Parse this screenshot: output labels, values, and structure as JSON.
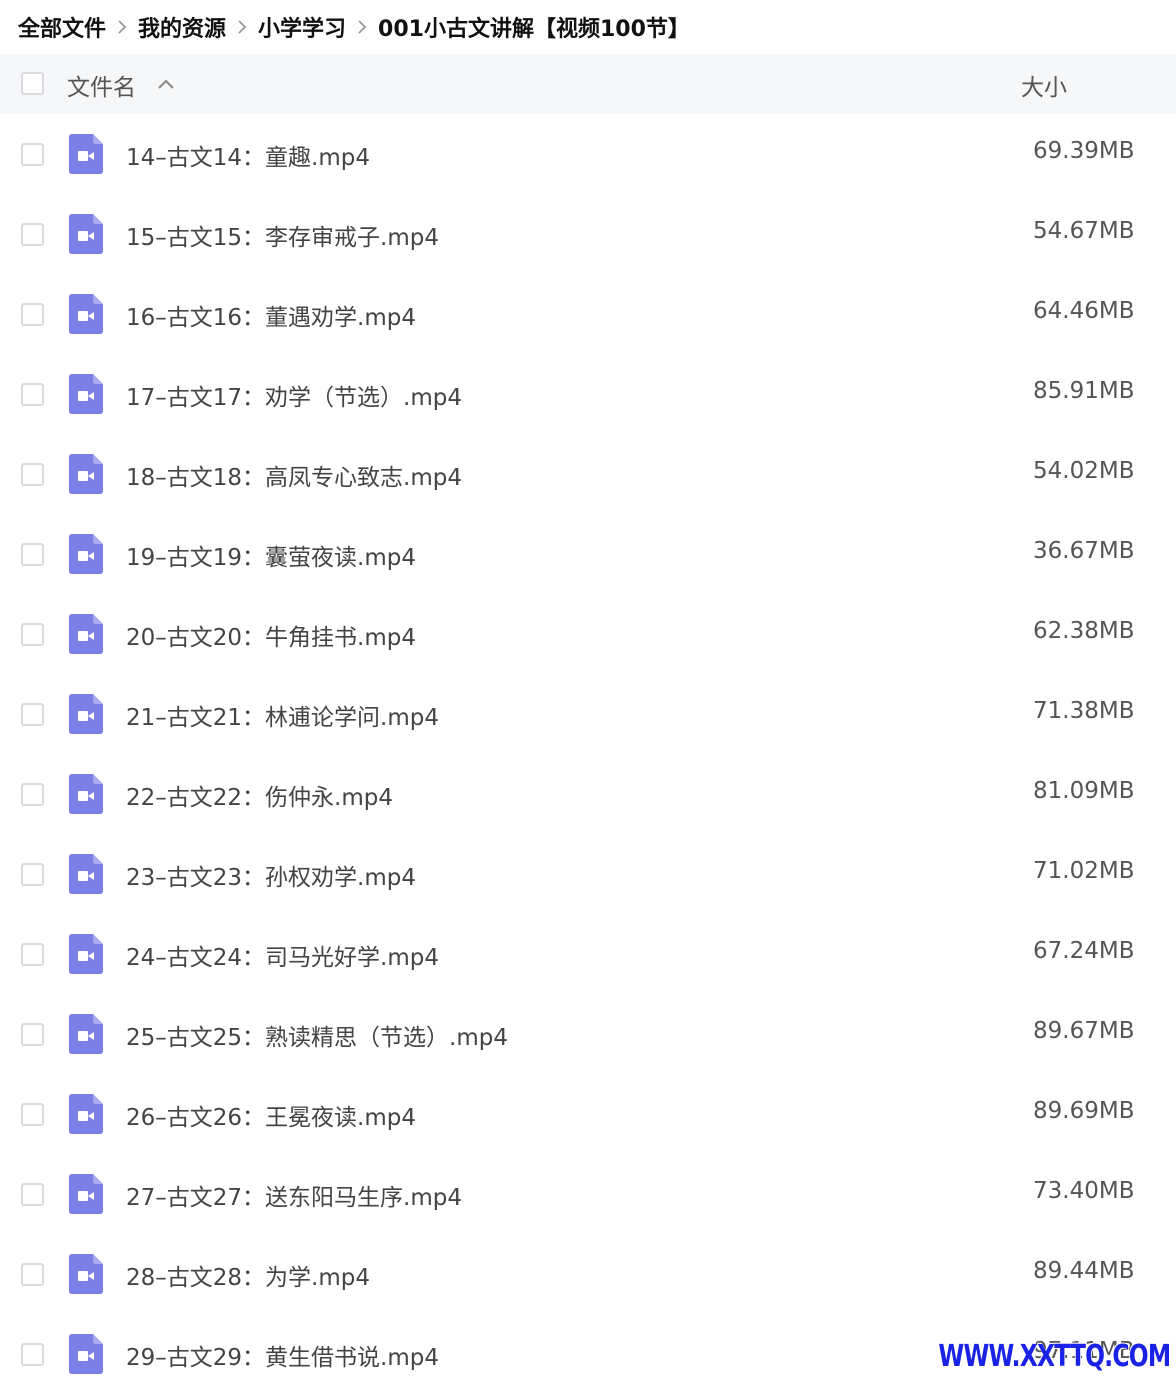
{
  "breadcrumb": {
    "items": [
      "全部文件",
      "我的资源",
      "小学学习",
      "001小古文讲解【视频100节】"
    ]
  },
  "header": {
    "name_label": "文件名",
    "size_label": "大小",
    "sort_icon": "chevron-up-icon"
  },
  "files": [
    {
      "name": "14–古文14：童趣.mp4",
      "size": "69.39MB"
    },
    {
      "name": "15–古文15：李存审戒子.mp4",
      "size": "54.67MB"
    },
    {
      "name": "16–古文16：董遇劝学.mp4",
      "size": "64.46MB"
    },
    {
      "name": "17–古文17：劝学（节选）.mp4",
      "size": "85.91MB"
    },
    {
      "name": "18–古文18：高凤专心致志.mp4",
      "size": "54.02MB"
    },
    {
      "name": "19–古文19：囊萤夜读.mp4",
      "size": "36.67MB"
    },
    {
      "name": "20–古文20：牛角挂书.mp4",
      "size": "62.38MB"
    },
    {
      "name": "21–古文21：林逋论学问.mp4",
      "size": "71.38MB"
    },
    {
      "name": "22–古文22：伤仲永.mp4",
      "size": "81.09MB"
    },
    {
      "name": "23–古文23：孙权劝学.mp4",
      "size": "71.02MB"
    },
    {
      "name": "24–古文24：司马光好学.mp4",
      "size": "67.24MB"
    },
    {
      "name": "25–古文25：熟读精思（节选）.mp4",
      "size": "89.67MB"
    },
    {
      "name": "26–古文26：王冕夜读.mp4",
      "size": "89.69MB"
    },
    {
      "name": "27–古文27：送东阳马生序.mp4",
      "size": "73.40MB"
    },
    {
      "name": "28–古文28：为学.mp4",
      "size": "89.44MB"
    },
    {
      "name": "29–古文29：黄生借书说.mp4",
      "size": "97.11MB"
    }
  ],
  "file_icon": "video-file-icon",
  "colors": {
    "icon_purple": "#7b7fe6",
    "header_bg": "#f6f7f9",
    "watermark": "#1a22e6"
  },
  "watermark": "WWW.XXTTQ.COM"
}
